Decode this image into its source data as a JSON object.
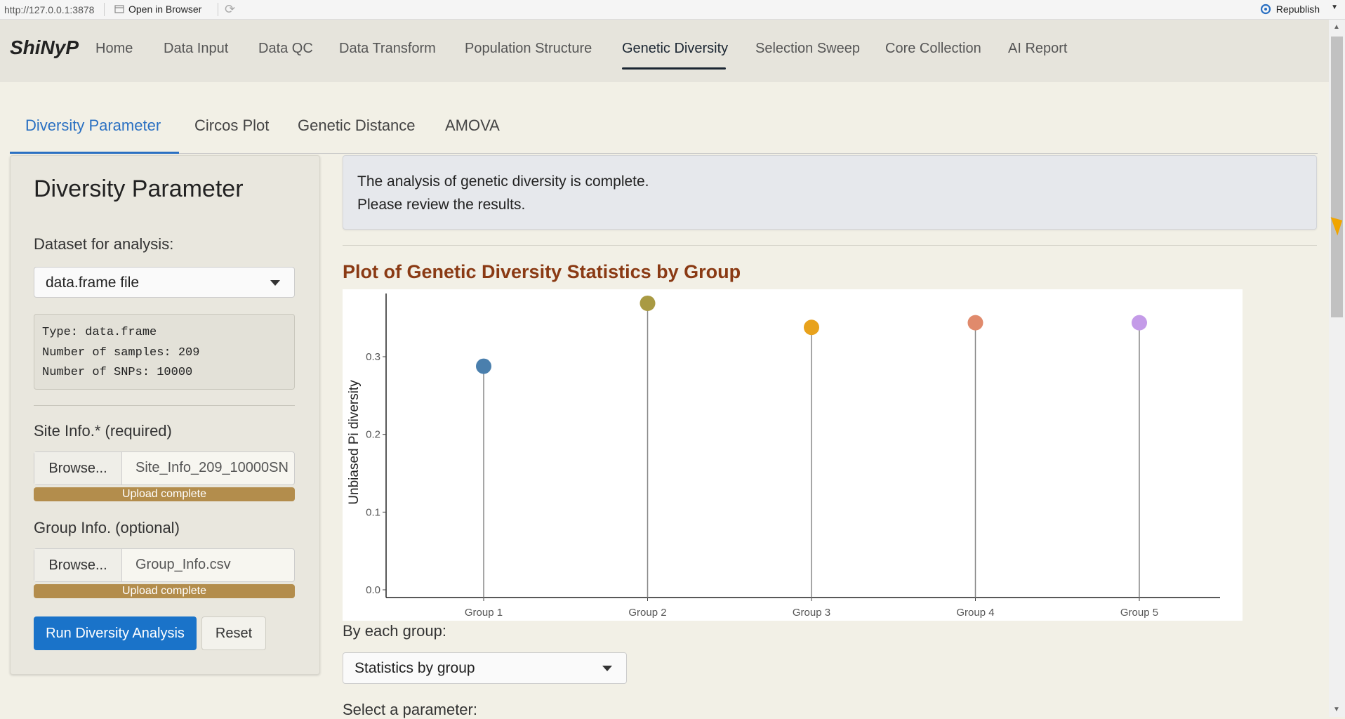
{
  "urlbar": {
    "url": "http://127.0.0.1:3878",
    "open_in_browser": "Open in Browser",
    "republish": "Republish"
  },
  "nav": {
    "brand": "ShiNyP",
    "items": [
      "Home",
      "Data Input",
      "Data QC",
      "Data Transform",
      "Population Structure",
      "Genetic Diversity",
      "Selection Sweep",
      "Core Collection",
      "AI Report"
    ],
    "active": "Genetic Diversity"
  },
  "subtabs": {
    "items": [
      "Diversity Parameter",
      "Circos Plot",
      "Genetic Distance",
      "AMOVA"
    ],
    "active": "Diversity Parameter"
  },
  "sidebar": {
    "title": "Diversity Parameter",
    "dataset_label": "Dataset for analysis:",
    "dataset_value": "data.frame file",
    "info_lines": [
      "Type: data.frame",
      "Number of samples: 209",
      "Number of SNPs: 10000"
    ],
    "site_label": "Site Info.* (required)",
    "site_browse": "Browse...",
    "site_file": "Site_Info_209_10000SN",
    "site_progress": "Upload complete",
    "group_label": "Group Info. (optional)",
    "group_browse": "Browse...",
    "group_file": "Group_Info.csv",
    "group_progress": "Upload complete",
    "run_button": "Run Diversity Analysis",
    "reset_button": "Reset"
  },
  "main": {
    "alert_line1": "The analysis of genetic diversity is complete.",
    "alert_line2": "Please review the results.",
    "plot_title": "Plot of Genetic Diversity Statistics by Group",
    "by_group_label": "By each group:",
    "by_group_value": "Statistics by group",
    "select_param_label": "Select a parameter:"
  },
  "chart_data": {
    "type": "lollipop",
    "categories": [
      "Group 1",
      "Group 2",
      "Group 3",
      "Group 4",
      "Group 5"
    ],
    "values": [
      0.285,
      0.366,
      0.335,
      0.341,
      0.341
    ],
    "colors": [
      "#4a7fad",
      "#a99a43",
      "#e8a21c",
      "#e08a6c",
      "#c49be8"
    ],
    "ylabel": "Unbiased Pi diversity",
    "xlabel": "",
    "yticks": [
      0.0,
      0.1,
      0.2,
      0.3
    ],
    "ytick_labels": [
      "0.0",
      "0.1",
      "0.2",
      "0.3"
    ],
    "ylim": [
      0,
      0.375
    ]
  }
}
